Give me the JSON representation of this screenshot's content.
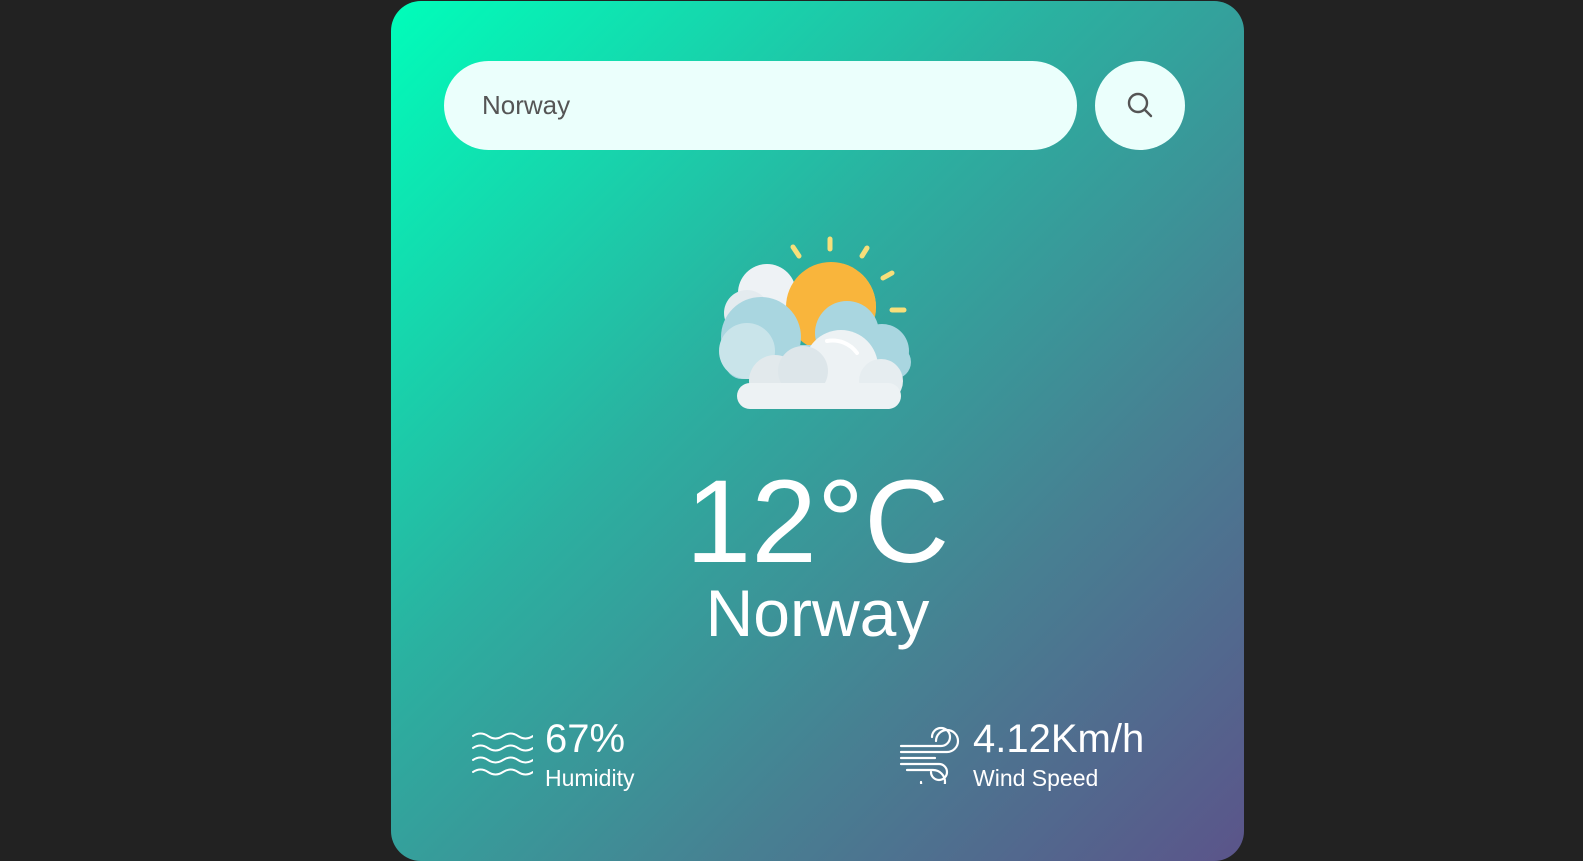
{
  "search": {
    "value": "Norway",
    "search_icon": "search-icon"
  },
  "weather": {
    "icon": "partly-cloudy-sun-icon",
    "temperature": "12°C",
    "city": "Norway"
  },
  "details": {
    "humidity": {
      "icon": "humidity-waves-icon",
      "value": "67%",
      "label": "Humidity"
    },
    "wind": {
      "icon": "wind-icon",
      "value": "4.12Km/h",
      "label": "Wind Speed"
    }
  },
  "colors": {
    "page_background": "#222222",
    "card_gradient_start": "#00feba",
    "card_gradient_end": "#5b548a",
    "input_background": "#ebfffc",
    "text": "#ffffff"
  }
}
